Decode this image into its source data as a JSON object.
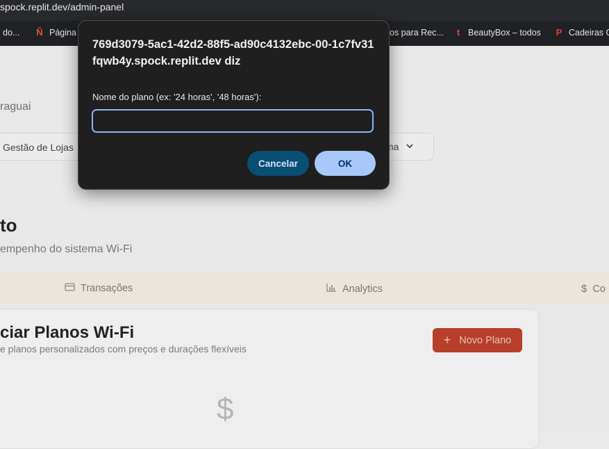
{
  "browser": {
    "url": "spock.replit.dev/admin-panel",
    "bookmarks": [
      {
        "label": "do...",
        "icon": "bookmark-icon"
      },
      {
        "label": "Página",
        "icon": "n-logo-icon"
      },
      {
        "label": "os para Rec...",
        "icon": "bookmark-icon"
      },
      {
        "label": "BeautyBox – todos",
        "icon": "t-logo-icon"
      },
      {
        "label": "Cadeiras G",
        "icon": "p-logo-icon"
      }
    ]
  },
  "page": {
    "region_text": "raguai",
    "nav_left": "Gestão de Lojas",
    "nav_right": "ma",
    "section_title": "to",
    "section_subtitle": "empenho do sistema Wi-Fi",
    "tabs": [
      {
        "label": "Transações",
        "icon": "card-icon"
      },
      {
        "label": "Analytics",
        "icon": "bar-chart-icon"
      },
      {
        "label": "Co",
        "icon": "dollar-icon"
      }
    ],
    "card_title": "ciar Planos Wi-Fi",
    "card_subtitle": "e planos personalizados com preços e durações flexíveis",
    "new_plan_label": "Novo Plano",
    "new_plan_plus": "+",
    "empty_icon": "$"
  },
  "dialog": {
    "origin": "769d3079-5ac1-42d2-88f5-ad90c4132ebc-00-1c7fv31fqwb4y.spock.replit.dev diz",
    "message": "Nome do plano (ex: '24 horas', '48 horas'):",
    "input_value": "",
    "cancel_label": "Cancelar",
    "ok_label": "OK"
  },
  "colors": {
    "dialog_bg": "#1f1f1f",
    "input_border": "#8ab4f8",
    "cancel_bg": "#094e75",
    "ok_bg": "#a8c7fa",
    "new_plan_bg": "#b8402b"
  }
}
